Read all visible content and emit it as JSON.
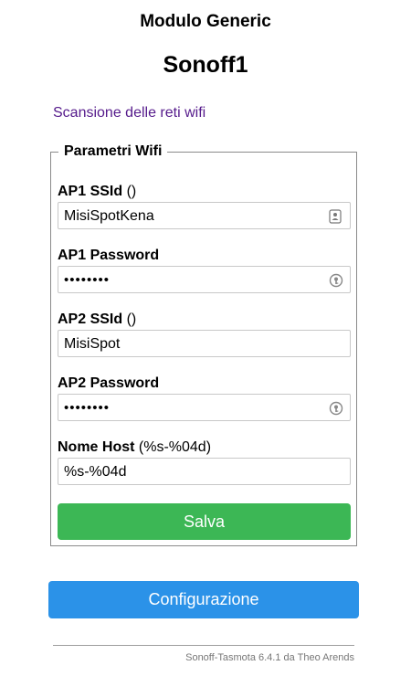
{
  "header": {
    "module_title": "Modulo Generic",
    "device_name": "Sonoff1"
  },
  "scan_link": "Scansione delle reti wifi",
  "wifi_params": {
    "legend": "Parametri Wifi",
    "ap1_ssid": {
      "label_bold": "AP1 SSId",
      "label_note": " ()",
      "value": "MisiSpotKena",
      "icon": "contact-card-icon"
    },
    "ap1_password": {
      "label_bold": "AP1 Password",
      "value": "••••••••",
      "icon": "key-icon"
    },
    "ap2_ssid": {
      "label_bold": "AP2 SSId",
      "label_note": " ()",
      "value": "MisiSpot"
    },
    "ap2_password": {
      "label_bold": "AP2 Password",
      "value": "••••••••",
      "icon": "key-icon"
    },
    "hostname": {
      "label_bold": "Nome Host",
      "label_note": " (%s-%04d)",
      "value": "%s-%04d"
    },
    "save_label": "Salva"
  },
  "config_button_label": "Configurazione",
  "footer": "Sonoff-Tasmota 6.4.1 da Theo Arends",
  "colors": {
    "save_button": "#3cb755",
    "config_button": "#2b92e8",
    "link": "#551a8b"
  }
}
